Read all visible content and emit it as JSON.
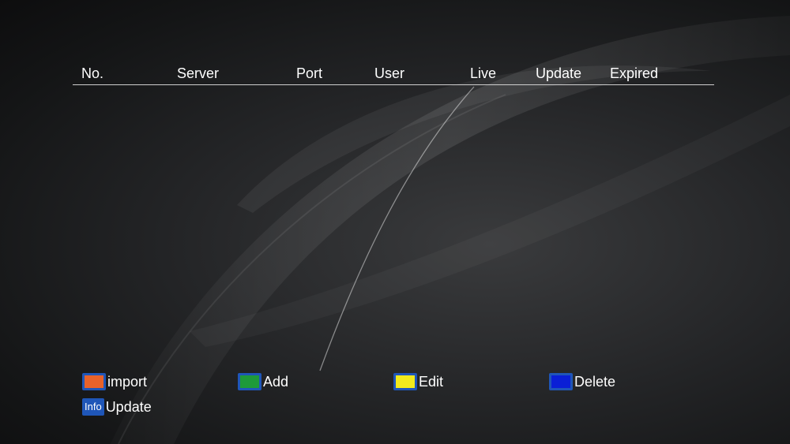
{
  "table": {
    "headers": [
      "No.",
      "Server",
      "Port",
      "User",
      "Live",
      "Update",
      "Expired"
    ],
    "rows": []
  },
  "keys": {
    "red": {
      "label": "import",
      "color": "#e8622a"
    },
    "green": {
      "label": "Add",
      "color": "#1e9a3a"
    },
    "yellow": {
      "label": "Edit",
      "color": "#f2ea1c"
    },
    "blue": {
      "label": "Delete",
      "color": "#0a1fd6"
    },
    "info": {
      "badge": "Info",
      "label": "Update"
    }
  }
}
